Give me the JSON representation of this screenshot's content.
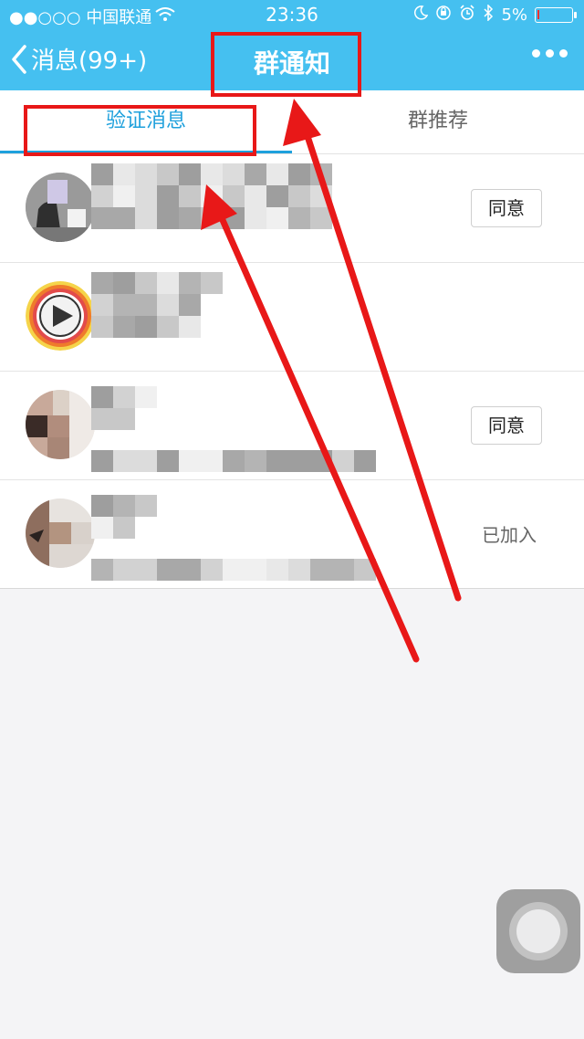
{
  "status_bar": {
    "carrier": "●●○○○ 中国联通",
    "time": "23:36",
    "battery": "5%",
    "battery_level": 0.05
  },
  "nav": {
    "back_label": "消息(99+)",
    "title": "群通知"
  },
  "tabs": [
    {
      "label": "验证消息",
      "active": true
    },
    {
      "label": "群推荐",
      "active": false
    }
  ],
  "rows": [
    {
      "action": "同意",
      "action_type": "button"
    },
    {
      "action": "",
      "action_type": "none"
    },
    {
      "action": "同意",
      "action_type": "button"
    },
    {
      "action": "已加入",
      "action_type": "status"
    }
  ],
  "colors": {
    "accent": "#45c0f0",
    "tab_active": "#1ea0dc",
    "annotation": "#e81818"
  }
}
